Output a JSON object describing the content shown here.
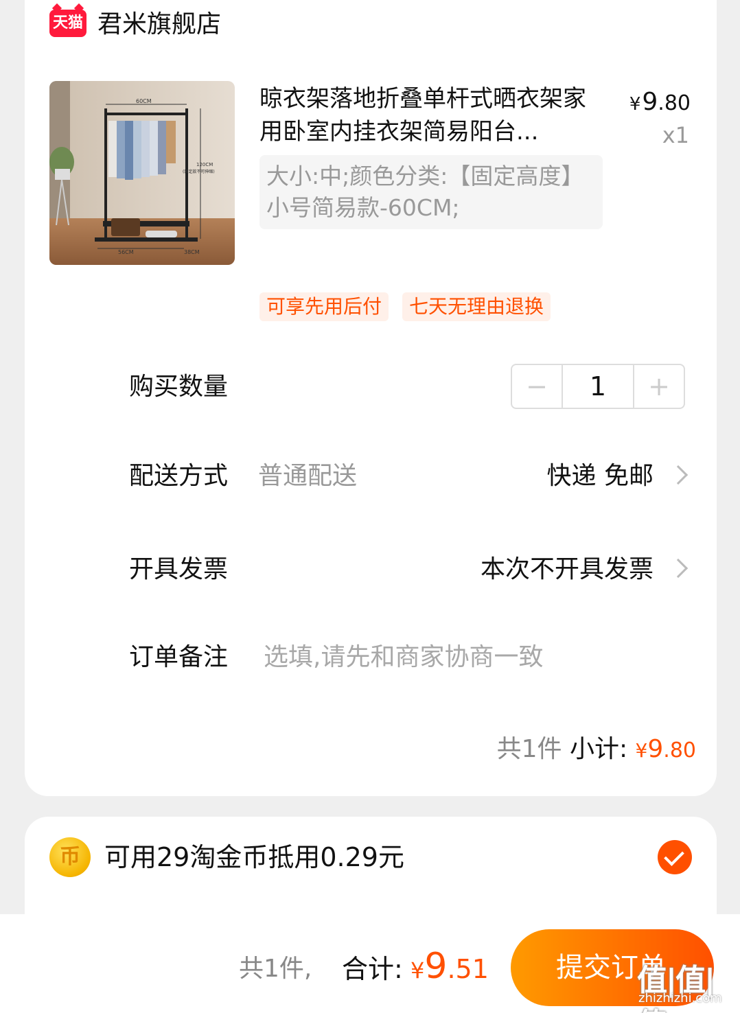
{
  "shop": {
    "badge_text": "天猫",
    "name": "君米旗舰店"
  },
  "product": {
    "title": "晾衣架落地折叠单杆式晒衣架家用卧室内挂衣架简易阳台...",
    "price_symbol": "¥",
    "price_int": "9",
    "price_dec": ".80",
    "quantity": "x1",
    "sku": "大小:中;颜色分类:【固定高度】小号简易款-60CM;",
    "image_labels": {
      "width": "60CM",
      "height": "120CM",
      "height_note": "(固定款不可伸缩)",
      "bottom": "56CM",
      "depth": "38CM"
    },
    "tags": [
      "可享先用后付",
      "七天无理由退换"
    ]
  },
  "rows": {
    "quantity": {
      "label": "购买数量",
      "value": "1",
      "minus": "−",
      "plus": "+"
    },
    "delivery": {
      "label": "配送方式",
      "option": "普通配送",
      "value": "快递 免邮"
    },
    "invoice": {
      "label": "开具发票",
      "value": "本次不开具发票"
    },
    "note": {
      "label": "订单备注",
      "placeholder": "选填,请先和商家协商一致"
    }
  },
  "subtotal": {
    "count": "共1件",
    "label": "小计:",
    "yen": "¥",
    "int": "9",
    "dec": ".80"
  },
  "coins": {
    "text": "可用29淘金币抵用0.29元",
    "checked": true
  },
  "footer": {
    "count": "共1件,",
    "label": "合计:",
    "yen": "¥",
    "int": "9",
    "dec": ".51",
    "submit": "提交订单"
  },
  "watermark": {
    "main": "值|值|值",
    "sub": "zhizhizhi.com"
  },
  "colors": {
    "accent": "#ff5000",
    "tmall_red": "#ff1a3c",
    "muted": "#999999"
  }
}
